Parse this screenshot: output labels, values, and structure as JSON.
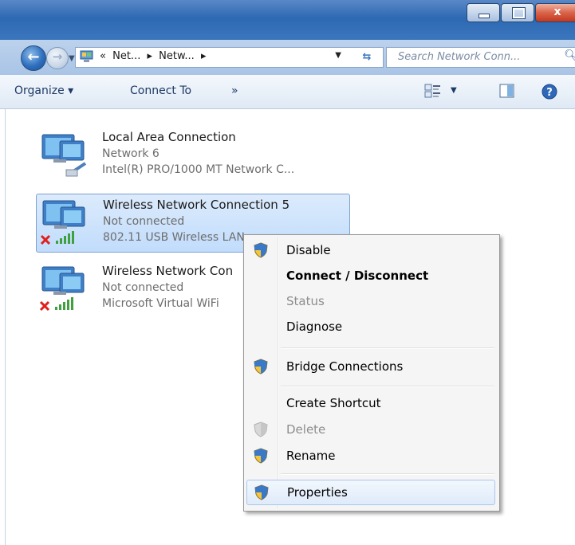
{
  "window": {
    "controls": {
      "minimize": "minimize",
      "maximize": "maximize",
      "close": "x"
    }
  },
  "address": {
    "prefix": "«",
    "crumbs": [
      "Net...",
      "▸",
      "Netw...",
      "▸"
    ],
    "search_placeholder": "Search Network Conn..."
  },
  "toolbar": {
    "organize": "Organize ▾",
    "connect_to": "Connect To",
    "more": "»"
  },
  "connections": [
    {
      "name": "Local Area Connection",
      "status": "Network 6",
      "device": "Intel(R) PRO/1000 MT Network C...",
      "type": "wired",
      "disconnected": false
    },
    {
      "name": "Wireless Network Connection 5",
      "status": "Not connected",
      "device": "802.11 USB Wireless LAN",
      "type": "wireless",
      "disconnected": true
    },
    {
      "name": "Wireless Network Con",
      "status": "Not connected",
      "device": "Microsoft Virtual WiFi",
      "type": "wireless",
      "disconnected": true
    }
  ],
  "context_menu": {
    "items": [
      {
        "label": "Disable",
        "icon": "uac-shield-icon",
        "style": "normal"
      },
      {
        "label": "Connect / Disconnect",
        "icon": "",
        "style": "bold"
      },
      {
        "label": "Status",
        "icon": "",
        "style": "disabled"
      },
      {
        "label": "Diagnose",
        "icon": "",
        "style": "normal"
      },
      {
        "label": "Bridge Connections",
        "icon": "uac-shield-icon",
        "style": "normal"
      },
      {
        "label": "Create Shortcut",
        "icon": "",
        "style": "normal"
      },
      {
        "label": "Delete",
        "icon": "uac-shield-disabled-icon",
        "style": "disabled"
      },
      {
        "label": "Rename",
        "icon": "uac-shield-icon",
        "style": "normal"
      },
      {
        "label": "Properties",
        "icon": "uac-shield-icon",
        "style": "hover"
      }
    ]
  },
  "colors": {
    "titlebar": "#2d69b3",
    "selection": "#c1dcfc",
    "menu_bg": "#f5f5f5"
  }
}
